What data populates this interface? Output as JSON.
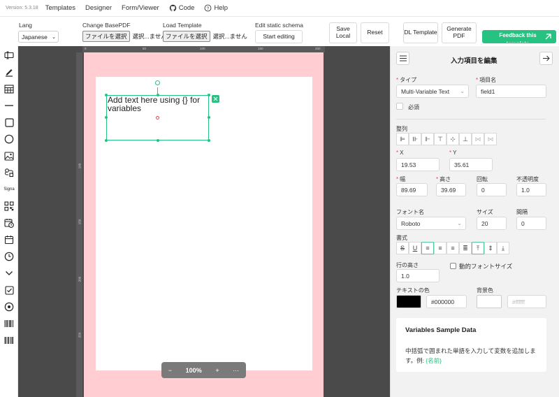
{
  "topbar": {
    "version": "Version: 5.3.18",
    "nav": [
      "Templates",
      "Designer",
      "Form/Viewer",
      "Code",
      "Help"
    ]
  },
  "toolbar": {
    "lang_label": "Lang",
    "lang_value": "Japanese",
    "change_base_label": "Change BasePDF",
    "load_template_label": "Load Template",
    "file_button": "ファイルを選択",
    "file_none": "選択...ません",
    "edit_schema_label": "Edit static schema",
    "start_editing": "Start editing",
    "save_local": "Save Local",
    "reset": "Reset",
    "dl_template": "DL Template",
    "generate_pdf": "Generate PDF",
    "feedback": "Feedback this template"
  },
  "sidebar": {
    "icons": [
      "text-field-icon",
      "pen-icon",
      "table-icon",
      "line-icon",
      "rectangle-icon",
      "ellipse-icon",
      "image-icon",
      "svg-icon",
      "signature-icon",
      "qrcode-icon",
      "date-time-icon",
      "calendar-icon",
      "clock-icon",
      "select-icon",
      "checkbox-icon",
      "radio-icon",
      "barcode-icon",
      "barcode-icon"
    ],
    "signature_label": "Signa"
  },
  "canvas": {
    "ruler_ticks": [
      "0",
      "50",
      "100",
      "150",
      "200"
    ],
    "ruler_left": [
      "100",
      "150",
      "200",
      "250"
    ],
    "field_text": "Add text here using {} for variables",
    "zoom": "100%",
    "zoom_out": "−",
    "zoom_in": "+",
    "more": "···"
  },
  "panel": {
    "title": "入力項目を編集",
    "type_label": "タイプ",
    "type_value": "Multi-Variable Text",
    "name_label": "項目名",
    "name_value": "field1",
    "required_label": "必須",
    "align_label": "整列",
    "x_label": "X",
    "x_value": "19.53",
    "y_label": "Y",
    "y_value": "35.61",
    "w_label": "幅",
    "w_value": "89.69",
    "h_label": "高さ",
    "h_value": "39.69",
    "rot_label": "回転",
    "rot_value": "0",
    "opacity_label": "不透明度",
    "opacity_value": "1.0",
    "font_label": "フォント名",
    "font_value": "Roboto",
    "size_label": "サイズ",
    "size_value": "20",
    "spacing_label": "間隔",
    "spacing_value": "0",
    "format_label": "書式",
    "lineheight_label": "行の高さ",
    "lineheight_value": "1.0",
    "dynamic_label": "動的フォントサイズ",
    "textcolor_label": "テキストの色",
    "textcolor_value": "#000000",
    "bgcolor_label": "背景色",
    "bgcolor_placeholder": "#ffffff",
    "vars_title": "Variables Sample Data",
    "vars_desc": "中括弧で囲まれた単語を入力して変数を追加します。例: ",
    "vars_example": "{名前}"
  },
  "colors": {
    "accent": "#25c281",
    "margin": "#ffcdd2",
    "handle": "#25c281"
  }
}
